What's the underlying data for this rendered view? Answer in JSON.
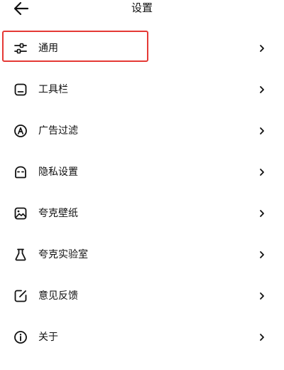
{
  "header": {
    "title": "设置",
    "back_icon": "arrow-left-icon"
  },
  "settings": {
    "items": [
      {
        "label": "通用",
        "icon": "sliders-icon",
        "highlighted": true
      },
      {
        "label": "工具栏",
        "icon": "toolbar-icon"
      },
      {
        "label": "广告过滤",
        "icon": "ad-block-icon"
      },
      {
        "label": "隐私设置",
        "icon": "privacy-mask-icon"
      },
      {
        "label": "夸克壁纸",
        "icon": "wallpaper-icon"
      },
      {
        "label": "夸克实验室",
        "icon": "flask-icon"
      },
      {
        "label": "意见反馈",
        "icon": "feedback-edit-icon"
      },
      {
        "label": "关于",
        "icon": "info-icon"
      }
    ]
  },
  "colors": {
    "highlight": "#e53935",
    "text": "#111111",
    "background": "#ffffff"
  }
}
